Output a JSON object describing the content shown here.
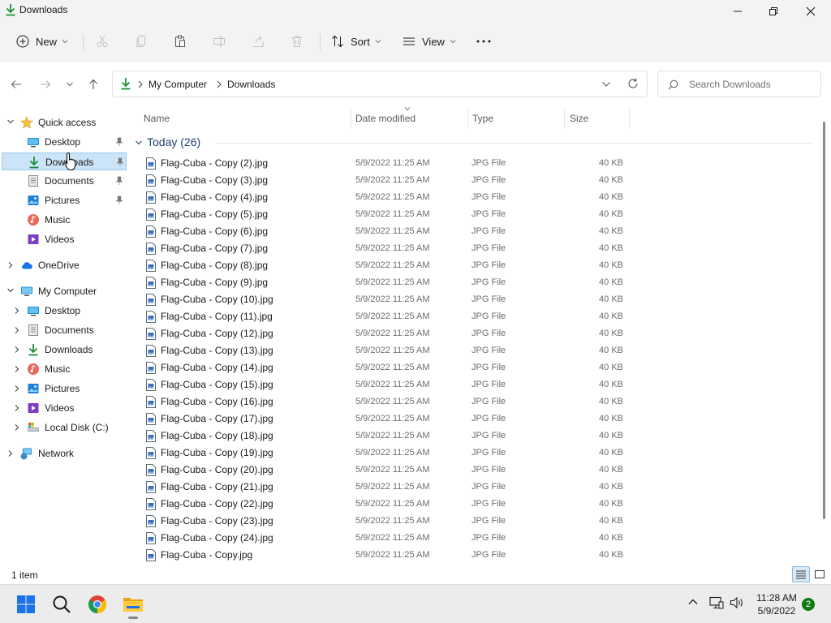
{
  "window": {
    "title": "Downloads"
  },
  "toolbar": {
    "new_label": "New",
    "sort_label": "Sort",
    "view_label": "View"
  },
  "address": {
    "crumbs": [
      "My Computer",
      "Downloads"
    ],
    "search_placeholder": "Search Downloads"
  },
  "sidebar": {
    "quick_access": "Quick access",
    "quick_items": [
      "Desktop",
      "Downloads",
      "Documents",
      "Pictures",
      "Music",
      "Videos"
    ],
    "onedrive": "OneDrive",
    "my_computer": "My Computer",
    "computer_items": [
      "Desktop",
      "Documents",
      "Downloads",
      "Music",
      "Pictures",
      "Videos",
      "Local Disk (C:)"
    ],
    "network": "Network"
  },
  "columns": {
    "name": "Name",
    "date": "Date modified",
    "type": "Type",
    "size": "Size"
  },
  "group": {
    "label": "Today (26)"
  },
  "files": [
    {
      "name": "Flag-Cuba - Copy (2).jpg",
      "date": "5/9/2022 11:25 AM",
      "type": "JPG File",
      "size": "40 KB"
    },
    {
      "name": "Flag-Cuba - Copy (3).jpg",
      "date": "5/9/2022 11:25 AM",
      "type": "JPG File",
      "size": "40 KB"
    },
    {
      "name": "Flag-Cuba - Copy (4).jpg",
      "date": "5/9/2022 11:25 AM",
      "type": "JPG File",
      "size": "40 KB"
    },
    {
      "name": "Flag-Cuba - Copy (5).jpg",
      "date": "5/9/2022 11:25 AM",
      "type": "JPG File",
      "size": "40 KB"
    },
    {
      "name": "Flag-Cuba - Copy (6).jpg",
      "date": "5/9/2022 11:25 AM",
      "type": "JPG File",
      "size": "40 KB"
    },
    {
      "name": "Flag-Cuba - Copy (7).jpg",
      "date": "5/9/2022 11:25 AM",
      "type": "JPG File",
      "size": "40 KB"
    },
    {
      "name": "Flag-Cuba - Copy (8).jpg",
      "date": "5/9/2022 11:25 AM",
      "type": "JPG File",
      "size": "40 KB"
    },
    {
      "name": "Flag-Cuba - Copy (9).jpg",
      "date": "5/9/2022 11:25 AM",
      "type": "JPG File",
      "size": "40 KB"
    },
    {
      "name": "Flag-Cuba - Copy (10).jpg",
      "date": "5/9/2022 11:25 AM",
      "type": "JPG File",
      "size": "40 KB"
    },
    {
      "name": "Flag-Cuba - Copy (11).jpg",
      "date": "5/9/2022 11:25 AM",
      "type": "JPG File",
      "size": "40 KB"
    },
    {
      "name": "Flag-Cuba - Copy (12).jpg",
      "date": "5/9/2022 11:25 AM",
      "type": "JPG File",
      "size": "40 KB"
    },
    {
      "name": "Flag-Cuba - Copy (13).jpg",
      "date": "5/9/2022 11:25 AM",
      "type": "JPG File",
      "size": "40 KB"
    },
    {
      "name": "Flag-Cuba - Copy (14).jpg",
      "date": "5/9/2022 11:25 AM",
      "type": "JPG File",
      "size": "40 KB"
    },
    {
      "name": "Flag-Cuba - Copy (15).jpg",
      "date": "5/9/2022 11:25 AM",
      "type": "JPG File",
      "size": "40 KB"
    },
    {
      "name": "Flag-Cuba - Copy (16).jpg",
      "date": "5/9/2022 11:25 AM",
      "type": "JPG File",
      "size": "40 KB"
    },
    {
      "name": "Flag-Cuba - Copy (17).jpg",
      "date": "5/9/2022 11:25 AM",
      "type": "JPG File",
      "size": "40 KB"
    },
    {
      "name": "Flag-Cuba - Copy (18).jpg",
      "date": "5/9/2022 11:25 AM",
      "type": "JPG File",
      "size": "40 KB"
    },
    {
      "name": "Flag-Cuba - Copy (19).jpg",
      "date": "5/9/2022 11:25 AM",
      "type": "JPG File",
      "size": "40 KB"
    },
    {
      "name": "Flag-Cuba - Copy (20).jpg",
      "date": "5/9/2022 11:25 AM",
      "type": "JPG File",
      "size": "40 KB"
    },
    {
      "name": "Flag-Cuba - Copy (21).jpg",
      "date": "5/9/2022 11:25 AM",
      "type": "JPG File",
      "size": "40 KB"
    },
    {
      "name": "Flag-Cuba - Copy (22).jpg",
      "date": "5/9/2022 11:25 AM",
      "type": "JPG File",
      "size": "40 KB"
    },
    {
      "name": "Flag-Cuba - Copy (23).jpg",
      "date": "5/9/2022 11:25 AM",
      "type": "JPG File",
      "size": "40 KB"
    },
    {
      "name": "Flag-Cuba - Copy (24).jpg",
      "date": "5/9/2022 11:25 AM",
      "type": "JPG File",
      "size": "40 KB"
    },
    {
      "name": "Flag-Cuba - Copy.jpg",
      "date": "5/9/2022 11:25 AM",
      "type": "JPG File",
      "size": "40 KB"
    }
  ],
  "status": {
    "text": "1 item"
  },
  "taskbar": {
    "time": "11:28 AM",
    "date": "5/9/2022",
    "notification_count": "2"
  },
  "colors": {
    "accent": "#0067c0",
    "selection": "#cce4f7",
    "download_green": "#1e8f3a"
  }
}
